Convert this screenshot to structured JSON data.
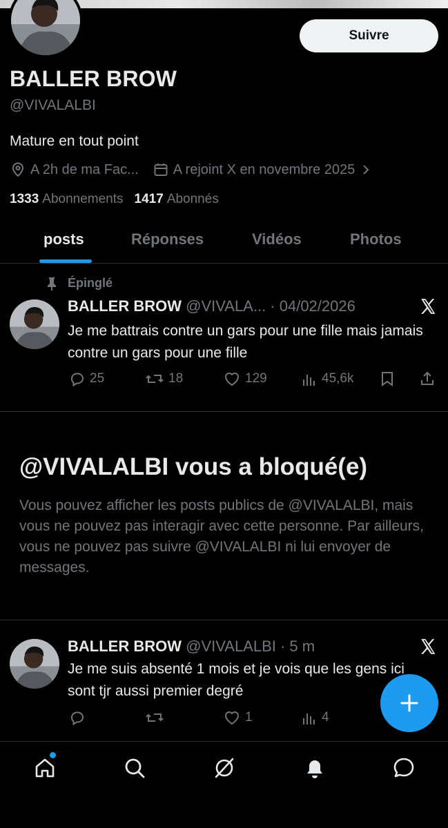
{
  "profile": {
    "name": "BALLER BROW",
    "handle": "@VIVALALBI",
    "bio": "Mature en tout point",
    "location": "A 2h de ma Fac...",
    "joined": "A rejoint X en novembre 2025",
    "following_count": "1333",
    "following_label": "Abonnements",
    "followers_count": "1417",
    "followers_label": "Abonnés",
    "follow_label": "Suivre"
  },
  "tabs": [
    {
      "label": "posts",
      "active": true
    },
    {
      "label": "Réponses",
      "active": false
    },
    {
      "label": "Vidéos",
      "active": false
    },
    {
      "label": "Photos",
      "active": false
    }
  ],
  "pinned_label": "Épinglé",
  "tweets": [
    {
      "name": "BALLER BROW",
      "handle_time": "@VIVALA... · 04/02/2026",
      "text": "Je me battrais contre un gars pour une fille mais jamais contre un gars pour une fille",
      "replies": "25",
      "reposts": "18",
      "likes": "129",
      "views": "45,6k"
    },
    {
      "name": "BALLER BROW",
      "handle_time": "@VIVALALBI · 5 m",
      "text": "Je me suis absenté 1 mois et je vois que les gens ici sont tjr aussi premier degré",
      "replies": "",
      "reposts": "",
      "likes": "1",
      "views": "4"
    }
  ],
  "blocked": {
    "title": "@VIVALALBI vous a bloqué(e)",
    "text": "Vous pouvez afficher les posts publics de @VIVALALBI, mais vous ne pouvez pas interagir avec cette personne. Par ailleurs, vous ne pouvez pas suivre @VIVALALBI ni lui envoyer de messages."
  },
  "colors": {
    "background": "#000000",
    "accent": "#1d9bf0",
    "text_primary": "#e7e9ea",
    "text_secondary": "#71767b",
    "divider": "#2f3336"
  },
  "icons": [
    "location-icon",
    "calendar-icon",
    "chevron-right-icon",
    "pin-icon",
    "x-logo-icon",
    "reply-icon",
    "repost-icon",
    "like-icon",
    "views-icon",
    "bookmark-icon",
    "share-icon",
    "compose-plus-icon",
    "home-icon",
    "search-icon",
    "grok-icon",
    "notifications-icon",
    "messages-icon"
  ]
}
